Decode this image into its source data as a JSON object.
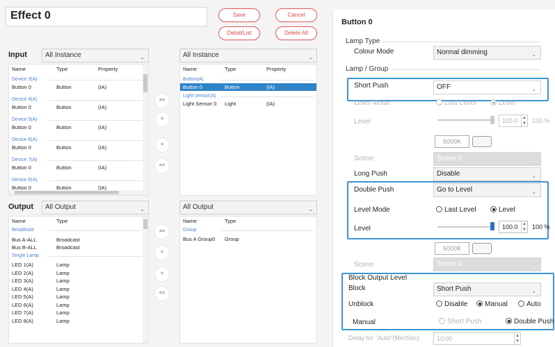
{
  "effect": {
    "title": "Effect 0"
  },
  "buttons": {
    "save": "Save",
    "cancel": "Cancel",
    "detail_list": "Detail/List",
    "delete_all": "Delete All"
  },
  "input": {
    "label": "Input",
    "filter": "All Instance",
    "headers": [
      "Name",
      "Type",
      "Property"
    ],
    "rows": [
      {
        "group": "Device 3(A)",
        "name": "Button 0",
        "type": "Button",
        "prop": "(IA)"
      },
      {
        "group": "Device 4(A)",
        "name": "Button 0",
        "type": "Button",
        "prop": "(IA)"
      },
      {
        "group": "Device 5(A)",
        "name": "Button 0",
        "type": "Button",
        "prop": "(IA)"
      },
      {
        "group": "Device 6(A)",
        "name": "Button 0",
        "type": "Button",
        "prop": "(IA)"
      },
      {
        "group": "Device 7(A)",
        "name": "Button 0",
        "type": "Button",
        "prop": "(IA)"
      },
      {
        "group": "Device 8(A)",
        "name": "Button 0",
        "type": "Button",
        "prop": "(IA)"
      }
    ]
  },
  "selected_input": {
    "filter": "All Instance",
    "headers": [
      "Name",
      "Type",
      "Property"
    ],
    "groups": [
      {
        "group": "Button(A)",
        "name": "Button 0",
        "type": "Button",
        "prop": "(IA)"
      },
      {
        "group": "Light sensor(A)",
        "name": "Light Sensor 0",
        "type": "Light",
        "prop": "(IA)"
      }
    ]
  },
  "output": {
    "label": "Output",
    "filter": "All Output",
    "headers": [
      "Name",
      "Type"
    ],
    "broadcast_group": "Broadcast",
    "broadcast": [
      {
        "name": "Bus A-ALL",
        "type": "Broadcast"
      },
      {
        "name": "Bus B-ALL",
        "type": "Broadcast"
      }
    ],
    "single_group": "Single Lamp",
    "lamps": [
      {
        "name": "LED 1(A)",
        "type": "Lamp"
      },
      {
        "name": "LED 2(A)",
        "type": "Lamp"
      },
      {
        "name": "LED 3(A)",
        "type": "Lamp"
      },
      {
        "name": "LED 4(A)",
        "type": "Lamp"
      },
      {
        "name": "LED 5(A)",
        "type": "Lamp"
      },
      {
        "name": "LED 6(A)",
        "type": "Lamp"
      },
      {
        "name": "LED 7(A)",
        "type": "Lamp"
      },
      {
        "name": "LED 8(A)",
        "type": "Lamp"
      }
    ]
  },
  "selected_output": {
    "filter": "All Output",
    "headers": [
      "Name",
      "Type"
    ],
    "group": "Group",
    "row": {
      "name": "Bus A Group0",
      "type": "Group"
    }
  },
  "arrows": {
    "add_all": ">>",
    "add": ">",
    "remove": "<",
    "remove_all": "<<"
  },
  "right": {
    "title": "Button 0",
    "lamp_type_label": "Lamp Type",
    "colour_mode_label": "Colour Mode",
    "colour_mode_value": "Normal dimming",
    "lamp_group_label": "Lamp / Group",
    "short_push_label": "Short Push",
    "short_push_value": "OFF",
    "level_mode_label": "Level Mode",
    "last_level": "Last Level",
    "level": "Level",
    "level_label": "Level",
    "level_value": "100.0",
    "level_percent": "100 %",
    "kelvin": "6000K",
    "scene_label": "Scene",
    "scene_value": "Scene 0",
    "long_push_label": "Long Push",
    "long_push_value": "Disable",
    "double_push_label": "Double Push",
    "double_push_value": "Go to Level",
    "dp_level_mode_label": "Level Mode",
    "dp_level_label": "Level",
    "dp_level_value": "100.0",
    "dp_level_percent": "100 %",
    "dp_kelvin": "6000K",
    "dp_scene_label": "Scene",
    "dp_scene_value": "Scene 0",
    "block_output_level_label": "Block Output Level",
    "block_label": "Block",
    "block_value": "Short Push",
    "unblock_label": "Unblock",
    "unblock_disable": "Disable",
    "unblock_manual": "Manual",
    "unblock_auto": "Auto",
    "manual_label": "Manual",
    "manual_short": "Short Push",
    "manual_double": "Double Push",
    "delay_label": "Delay for \"Auto\"(Min/Sec)",
    "delay_value": "10:00"
  }
}
